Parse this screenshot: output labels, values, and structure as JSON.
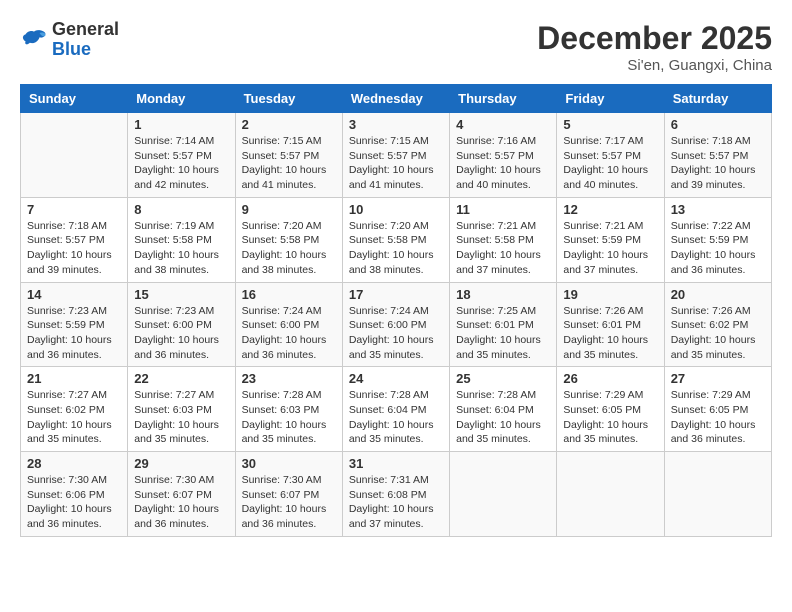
{
  "header": {
    "logo_line1": "General",
    "logo_line2": "Blue",
    "month_title": "December 2025",
    "location": "Si'en, Guangxi, China"
  },
  "columns": [
    "Sunday",
    "Monday",
    "Tuesday",
    "Wednesday",
    "Thursday",
    "Friday",
    "Saturday"
  ],
  "weeks": [
    [
      {
        "day": "",
        "sunrise": "",
        "sunset": "",
        "daylight": ""
      },
      {
        "day": "1",
        "sunrise": "7:14 AM",
        "sunset": "5:57 PM",
        "daylight": "10 hours and 42 minutes."
      },
      {
        "day": "2",
        "sunrise": "7:15 AM",
        "sunset": "5:57 PM",
        "daylight": "10 hours and 41 minutes."
      },
      {
        "day": "3",
        "sunrise": "7:15 AM",
        "sunset": "5:57 PM",
        "daylight": "10 hours and 41 minutes."
      },
      {
        "day": "4",
        "sunrise": "7:16 AM",
        "sunset": "5:57 PM",
        "daylight": "10 hours and 40 minutes."
      },
      {
        "day": "5",
        "sunrise": "7:17 AM",
        "sunset": "5:57 PM",
        "daylight": "10 hours and 40 minutes."
      },
      {
        "day": "6",
        "sunrise": "7:18 AM",
        "sunset": "5:57 PM",
        "daylight": "10 hours and 39 minutes."
      }
    ],
    [
      {
        "day": "7",
        "sunrise": "7:18 AM",
        "sunset": "5:57 PM",
        "daylight": "10 hours and 39 minutes."
      },
      {
        "day": "8",
        "sunrise": "7:19 AM",
        "sunset": "5:58 PM",
        "daylight": "10 hours and 38 minutes."
      },
      {
        "day": "9",
        "sunrise": "7:20 AM",
        "sunset": "5:58 PM",
        "daylight": "10 hours and 38 minutes."
      },
      {
        "day": "10",
        "sunrise": "7:20 AM",
        "sunset": "5:58 PM",
        "daylight": "10 hours and 38 minutes."
      },
      {
        "day": "11",
        "sunrise": "7:21 AM",
        "sunset": "5:58 PM",
        "daylight": "10 hours and 37 minutes."
      },
      {
        "day": "12",
        "sunrise": "7:21 AM",
        "sunset": "5:59 PM",
        "daylight": "10 hours and 37 minutes."
      },
      {
        "day": "13",
        "sunrise": "7:22 AM",
        "sunset": "5:59 PM",
        "daylight": "10 hours and 36 minutes."
      }
    ],
    [
      {
        "day": "14",
        "sunrise": "7:23 AM",
        "sunset": "5:59 PM",
        "daylight": "10 hours and 36 minutes."
      },
      {
        "day": "15",
        "sunrise": "7:23 AM",
        "sunset": "6:00 PM",
        "daylight": "10 hours and 36 minutes."
      },
      {
        "day": "16",
        "sunrise": "7:24 AM",
        "sunset": "6:00 PM",
        "daylight": "10 hours and 36 minutes."
      },
      {
        "day": "17",
        "sunrise": "7:24 AM",
        "sunset": "6:00 PM",
        "daylight": "10 hours and 35 minutes."
      },
      {
        "day": "18",
        "sunrise": "7:25 AM",
        "sunset": "6:01 PM",
        "daylight": "10 hours and 35 minutes."
      },
      {
        "day": "19",
        "sunrise": "7:26 AM",
        "sunset": "6:01 PM",
        "daylight": "10 hours and 35 minutes."
      },
      {
        "day": "20",
        "sunrise": "7:26 AM",
        "sunset": "6:02 PM",
        "daylight": "10 hours and 35 minutes."
      }
    ],
    [
      {
        "day": "21",
        "sunrise": "7:27 AM",
        "sunset": "6:02 PM",
        "daylight": "10 hours and 35 minutes."
      },
      {
        "day": "22",
        "sunrise": "7:27 AM",
        "sunset": "6:03 PM",
        "daylight": "10 hours and 35 minutes."
      },
      {
        "day": "23",
        "sunrise": "7:28 AM",
        "sunset": "6:03 PM",
        "daylight": "10 hours and 35 minutes."
      },
      {
        "day": "24",
        "sunrise": "7:28 AM",
        "sunset": "6:04 PM",
        "daylight": "10 hours and 35 minutes."
      },
      {
        "day": "25",
        "sunrise": "7:28 AM",
        "sunset": "6:04 PM",
        "daylight": "10 hours and 35 minutes."
      },
      {
        "day": "26",
        "sunrise": "7:29 AM",
        "sunset": "6:05 PM",
        "daylight": "10 hours and 35 minutes."
      },
      {
        "day": "27",
        "sunrise": "7:29 AM",
        "sunset": "6:05 PM",
        "daylight": "10 hours and 36 minutes."
      }
    ],
    [
      {
        "day": "28",
        "sunrise": "7:30 AM",
        "sunset": "6:06 PM",
        "daylight": "10 hours and 36 minutes."
      },
      {
        "day": "29",
        "sunrise": "7:30 AM",
        "sunset": "6:07 PM",
        "daylight": "10 hours and 36 minutes."
      },
      {
        "day": "30",
        "sunrise": "7:30 AM",
        "sunset": "6:07 PM",
        "daylight": "10 hours and 36 minutes."
      },
      {
        "day": "31",
        "sunrise": "7:31 AM",
        "sunset": "6:08 PM",
        "daylight": "10 hours and 37 minutes."
      },
      {
        "day": "",
        "sunrise": "",
        "sunset": "",
        "daylight": ""
      },
      {
        "day": "",
        "sunrise": "",
        "sunset": "",
        "daylight": ""
      },
      {
        "day": "",
        "sunrise": "",
        "sunset": "",
        "daylight": ""
      }
    ]
  ]
}
